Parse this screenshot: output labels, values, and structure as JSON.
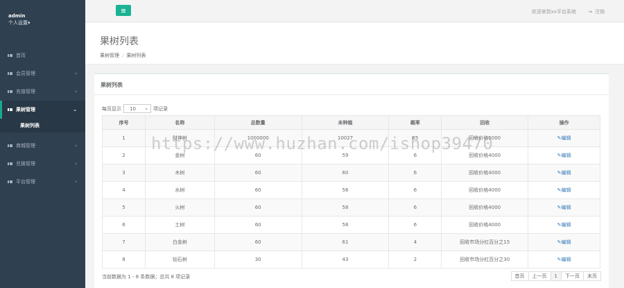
{
  "sidebar": {
    "username": "admin",
    "settings_label": "个人设置▾",
    "items": [
      {
        "label": "首页",
        "has_chevron": false
      },
      {
        "label": "会员管理",
        "has_chevron": true
      },
      {
        "label": "充值管理",
        "has_chevron": true
      },
      {
        "label": "果树管理",
        "has_chevron": true,
        "active": true
      },
      {
        "label": "商城管理",
        "has_chevron": true
      },
      {
        "label": "兑换管理",
        "has_chevron": true
      },
      {
        "label": "平台管理",
        "has_chevron": true
      }
    ],
    "sub_item": "果树列表"
  },
  "topbar": {
    "welcome": "欢迎来到xx平台系统",
    "logout": "注销",
    "accent": "#1ab394"
  },
  "page": {
    "title": "果树列表",
    "breadcrumb": [
      "果树管理",
      "果树列表"
    ]
  },
  "panel": {
    "title": "果树列表",
    "length_prefix": "每页显示",
    "length_value": "10",
    "length_suffix": "项记录"
  },
  "table": {
    "headers": [
      "序号",
      "名称",
      "总数量",
      "未种植",
      "概率",
      "回收",
      "操作"
    ],
    "rows": [
      [
        "1",
        "财神树",
        "1000000",
        "10027",
        "65",
        "回收价格5000",
        "编辑"
      ],
      [
        "2",
        "金树",
        "60",
        "59",
        "6",
        "回收价格4000",
        "编辑"
      ],
      [
        "3",
        "木树",
        "60",
        "60",
        "6",
        "回收价格4000",
        "编辑"
      ],
      [
        "4",
        "水树",
        "60",
        "56",
        "6",
        "回收价格4000",
        "编辑"
      ],
      [
        "5",
        "火树",
        "60",
        "58",
        "6",
        "回收价格4000",
        "编辑"
      ],
      [
        "6",
        "土树",
        "60",
        "58",
        "6",
        "回收价格4000",
        "编辑"
      ],
      [
        "7",
        "白金树",
        "60",
        "61",
        "4",
        "回收市场分红百分之15",
        "编辑"
      ],
      [
        "8",
        "钻石树",
        "30",
        "43",
        "2",
        "回收市场分红百分之30",
        "编辑"
      ]
    ]
  },
  "footer": {
    "info": "当前数据为 1 - 8 条数据；总共 8 项记录",
    "pager": [
      "首页",
      "上一页",
      "1",
      "下一页",
      "末页"
    ]
  },
  "watermark": "https://www.huzhan.com/ishop39470"
}
